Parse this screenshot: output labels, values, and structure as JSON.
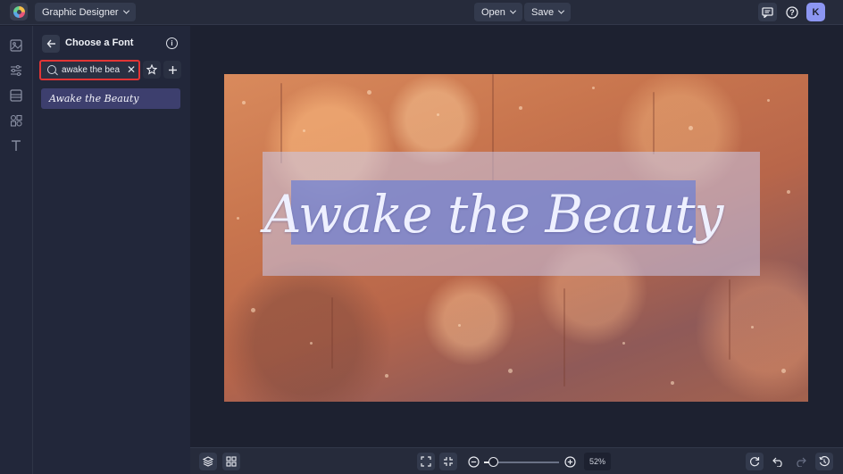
{
  "app": {
    "project_name": "Graphic Designer",
    "open_label": "Open",
    "save_label": "Save",
    "user_initial": "K"
  },
  "rail": {
    "items": [
      "image-icon",
      "sliders-icon",
      "layout-icon",
      "shapes-icon",
      "text-icon"
    ]
  },
  "font_panel": {
    "title": "Choose a Font",
    "search_value": "awake the bea",
    "results": [
      {
        "font_name": "Awake the Beauty",
        "selected": true
      }
    ]
  },
  "canvas": {
    "headline": "Awake the Beauty"
  },
  "bottom": {
    "zoom_percent": 52,
    "zoom_label": "52%",
    "zoom_slider_fraction": 0.12
  },
  "colors": {
    "search_highlight": "#e33535",
    "selected_font_row": "#3d3f6e",
    "avatar": "#8c96f2"
  }
}
